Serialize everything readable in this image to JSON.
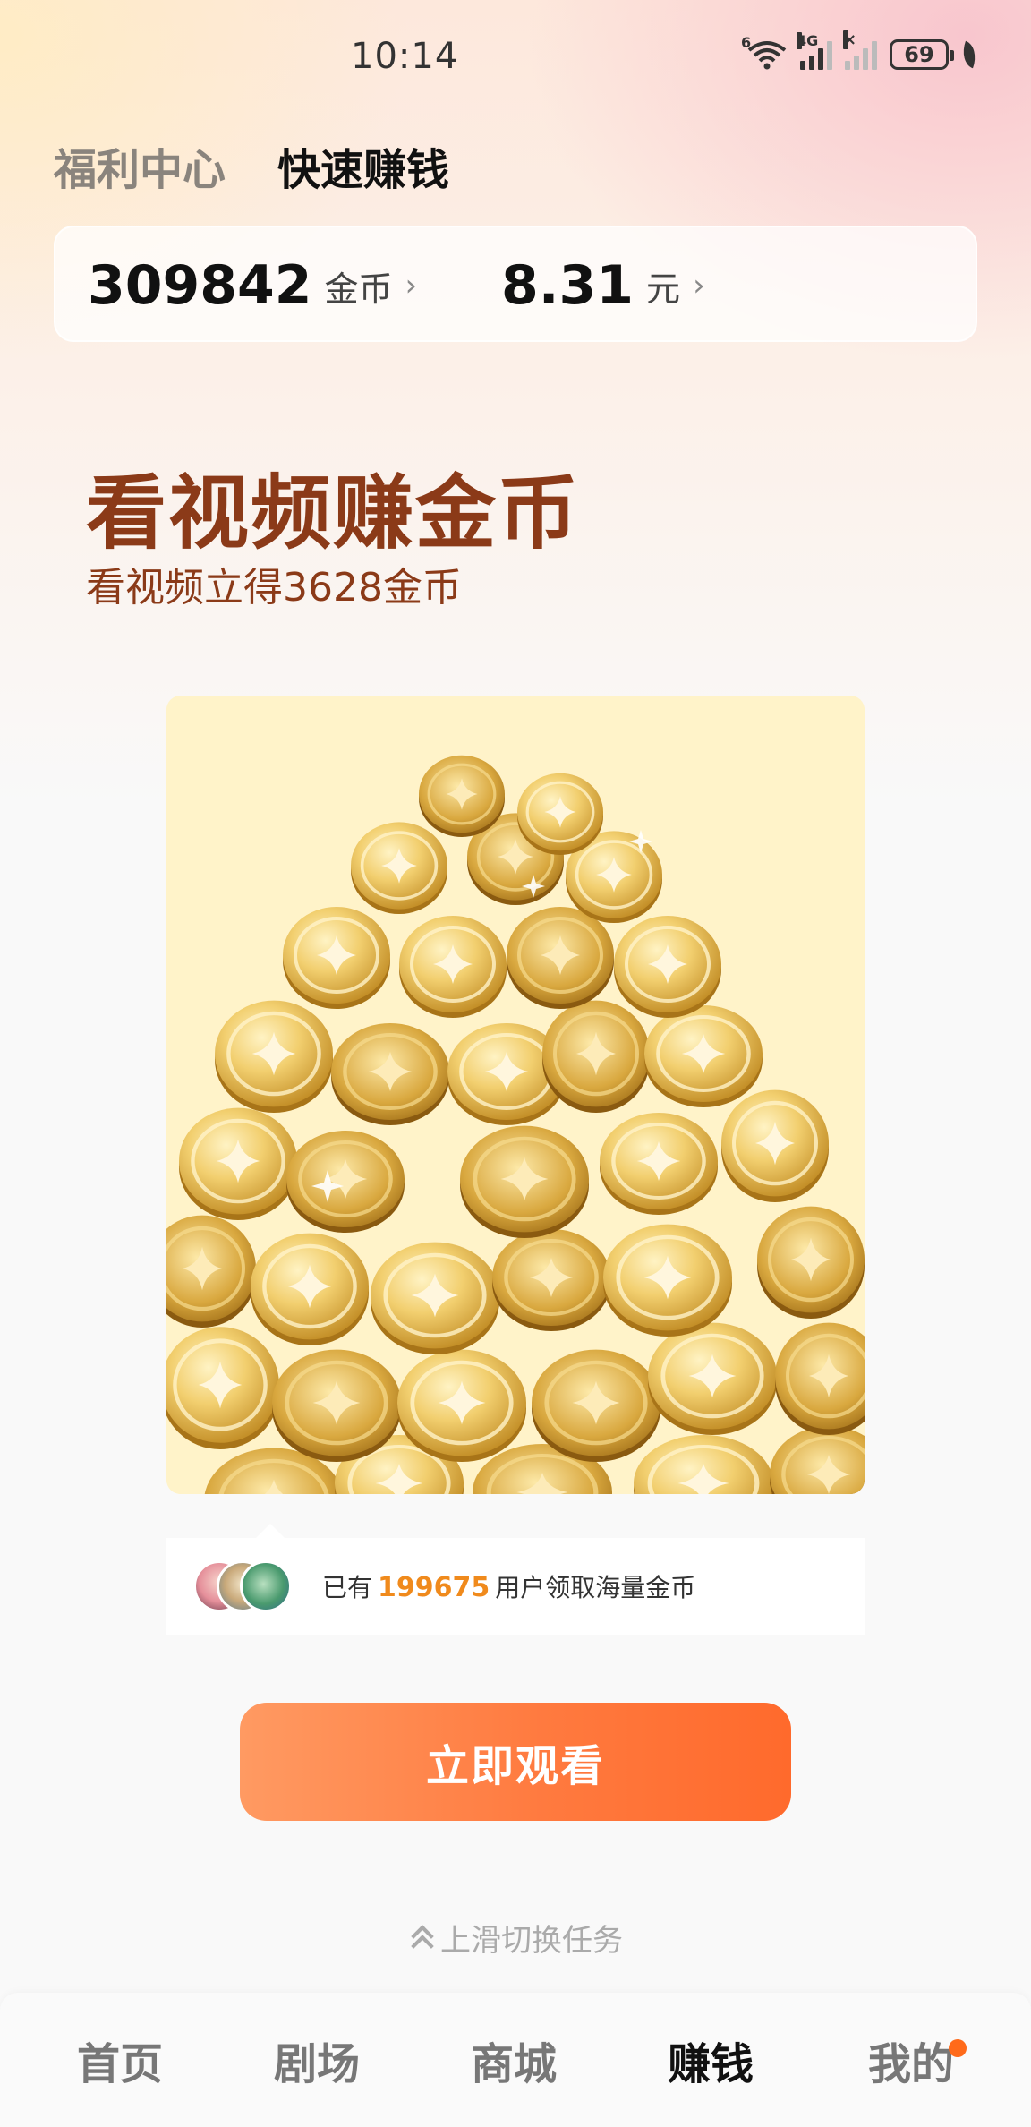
{
  "status_bar": {
    "time": "10:14",
    "battery": "69",
    "network_label": "4G",
    "wifi_badge": "6"
  },
  "top_tabs": [
    {
      "label": "福利中心",
      "active": false
    },
    {
      "label": "快速赚钱",
      "active": true
    }
  ],
  "balance": {
    "coins_value": "309842",
    "coins_unit": "金币",
    "cash_value": "8.31",
    "cash_unit": "元",
    "arrow": "›"
  },
  "hero": {
    "title": "看视频赚金币",
    "subtitle": "看视频立得3628金币"
  },
  "users_bar": {
    "prefix": "已有",
    "count": "199675",
    "suffix": "用户领取海量金币"
  },
  "watch_button": {
    "label": "立即观看"
  },
  "swipe_hint": {
    "label": "上滑切换任务"
  },
  "bottom_nav": [
    {
      "label": "首页",
      "active": false
    },
    {
      "label": "剧场",
      "active": false
    },
    {
      "label": "商城",
      "active": false
    },
    {
      "label": "赚钱",
      "active": true
    },
    {
      "label": "我的",
      "active": false,
      "badge_color": "#ff6a1a"
    }
  ],
  "colors": {
    "accent_orange": "#ff7a3f",
    "hero_brown": "#8b3a18",
    "count_orange": "#f08a1c"
  }
}
